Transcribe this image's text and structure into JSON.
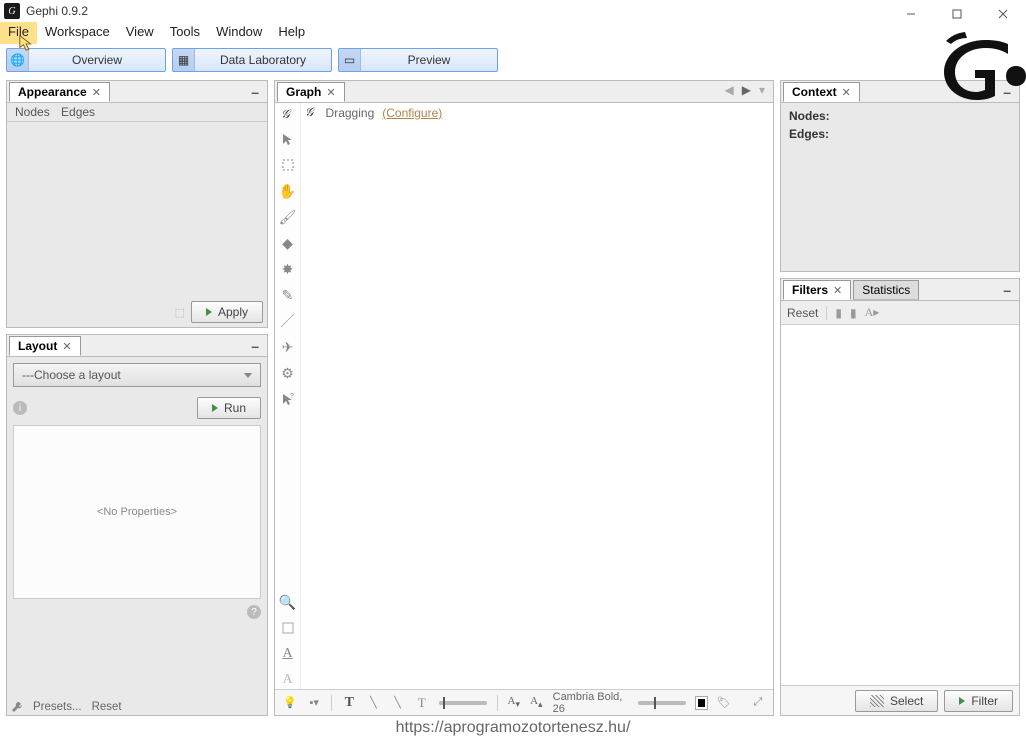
{
  "titlebar": {
    "title": "Gephi 0.9.2"
  },
  "menubar": {
    "items": [
      "File",
      "Workspace",
      "View",
      "Tools",
      "Window",
      "Help"
    ]
  },
  "view_tabs": {
    "overview": "Overview",
    "datalab": "Data Laboratory",
    "preview": "Preview"
  },
  "appearance": {
    "title": "Appearance",
    "sub_nodes": "Nodes",
    "sub_edges": "Edges",
    "apply": "Apply"
  },
  "layout": {
    "title": "Layout",
    "placeholder": "---Choose a layout",
    "run": "Run",
    "no_props": "<No Properties>",
    "presets": "Presets...",
    "reset": "Reset"
  },
  "graph": {
    "title": "Graph",
    "dragging": "Dragging",
    "configure": "(Configure)",
    "font": "Cambria Bold, 26"
  },
  "context": {
    "title": "Context",
    "nodes": "Nodes:",
    "edges": "Edges:"
  },
  "filters": {
    "title": "Filters",
    "stats": "Statistics",
    "reset": "Reset",
    "select": "Select",
    "filter": "Filter"
  },
  "footer": {
    "url": "https://aprogramozotortenesz.hu/"
  }
}
